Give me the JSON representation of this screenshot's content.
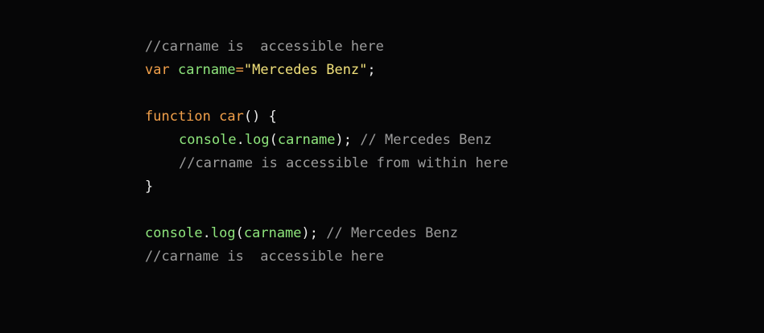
{
  "code": {
    "lines": [
      {
        "comment": "//carname is  accessible here"
      },
      {
        "kw": "var",
        "ident": "carname",
        "op": "=",
        "str": "\"Mercedes Benz\"",
        "punc": ";"
      },
      {
        "blank": ""
      },
      {
        "kw": "function",
        "fn": "car",
        "punc": "() {"
      },
      {
        "obj": "console",
        "dot": ".",
        "method": "log",
        "open": "(",
        "arg": "carname",
        "close": ");",
        "comment": "// Mercedes Benz"
      },
      {
        "comment": "//carname is accessible from within here"
      },
      {
        "punc": "}"
      },
      {
        "blank": ""
      },
      {
        "obj": "console",
        "dot": ".",
        "method": "log",
        "open": "(",
        "arg": "carname",
        "close": ");",
        "comment": "// Mercedes Benz"
      },
      {
        "comment": "//carname is  accessible here"
      }
    ]
  },
  "colors": {
    "background": "#060607",
    "keyword": "#f2a04a",
    "identifier": "#8ee57c",
    "string": "#f0e07a",
    "comment": "#9c9c9c",
    "punctuation": "#e8e8e8"
  }
}
